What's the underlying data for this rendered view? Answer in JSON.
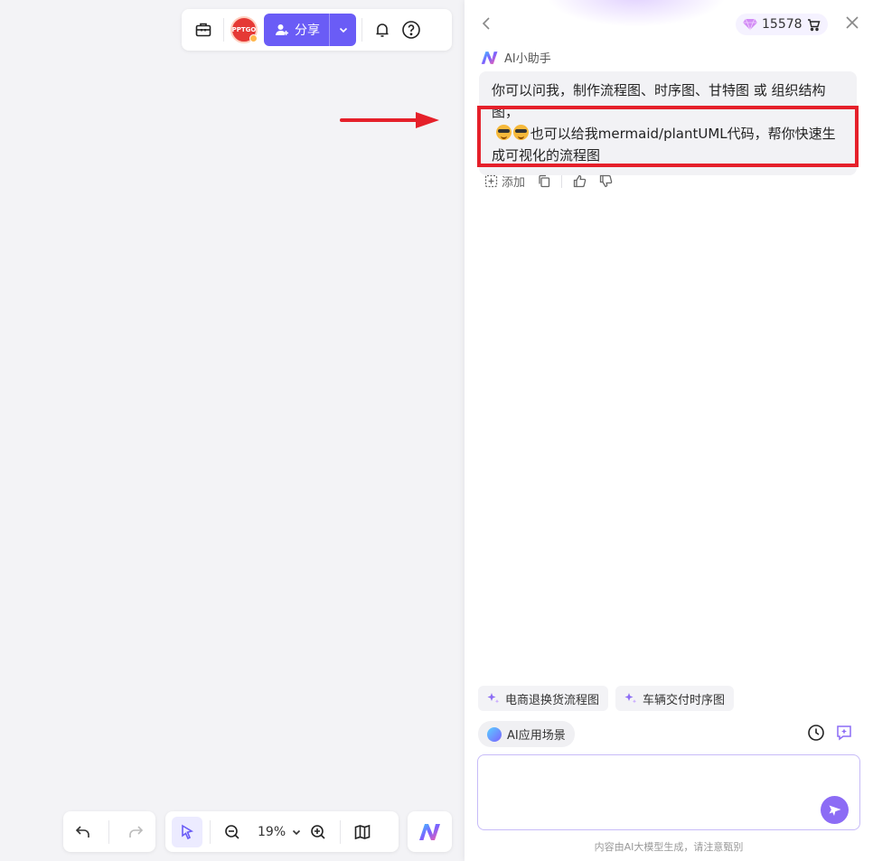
{
  "toolbar": {
    "avatar_text": "PPTGO",
    "share_label": "分享"
  },
  "bottom": {
    "zoom": "19%"
  },
  "panel": {
    "credits": "15578",
    "assistant_name": "AI小助手",
    "message": {
      "line1": "你可以问我，制作流程图、时序图、甘特图 或 组织结构图，",
      "line2": "也可以给我mermaid/plantUML代码，帮你快速生成可视化的流程图"
    },
    "actions": {
      "add_label": "添加"
    },
    "suggestions": [
      "电商退换货流程图",
      "车辆交付时序图"
    ],
    "scene_label": "AI应用场景",
    "input": {
      "value": "",
      "placeholder": ""
    },
    "disclaimer": "内容由AI大模型生成，请注意甄别"
  },
  "colors": {
    "accent": "#6a5cf6",
    "highlight": "#e5202a",
    "send": "#8c6cf5"
  }
}
